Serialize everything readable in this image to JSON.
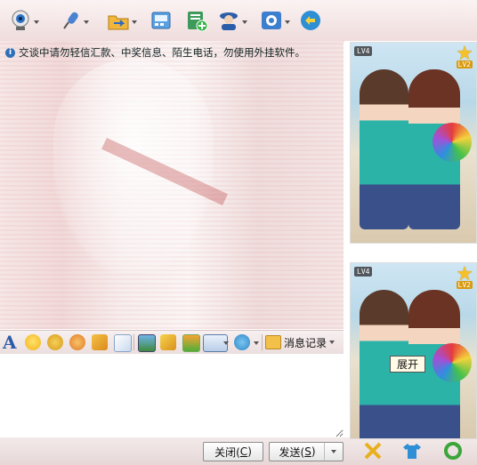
{
  "toolbar": {
    "items": [
      {
        "icon": "webcam-icon",
        "label": "视频"
      },
      {
        "icon": "microphone-icon",
        "label": "语音"
      },
      {
        "icon": "folder-transfer-icon",
        "label": "传送文件"
      },
      {
        "icon": "sms-icon",
        "label": "发送短信"
      },
      {
        "icon": "create-group-icon",
        "label": "创建讨论组"
      },
      {
        "icon": "user-info-icon",
        "label": "个人资料"
      },
      {
        "icon": "app-settings-icon",
        "label": "应用"
      },
      {
        "icon": "remote-assist-icon",
        "label": "远程协助"
      }
    ]
  },
  "warning": {
    "text": "交谈中请勿轻信汇款、中奖信息、陌生电话，勿使用外挂软件。"
  },
  "format_bar": {
    "font_icon": "A",
    "history_label": "消息记录"
  },
  "input": {
    "value": ""
  },
  "buttons": {
    "close_label_pre": "关闭(",
    "close_key": "C",
    "close_label_post": ")",
    "send_label_pre": "发送(",
    "send_key": "S",
    "send_label_post": ")"
  },
  "profile_top": {
    "badge": "LV4",
    "level": "LV2"
  },
  "profile_bottom": {
    "badge": "LV4",
    "level": "LV2"
  },
  "tooltip": {
    "text": "展开"
  },
  "colors": {
    "accent": "#2a5aa8",
    "toolbar_bg": "#efdcdc",
    "star": "#f6c02a"
  }
}
